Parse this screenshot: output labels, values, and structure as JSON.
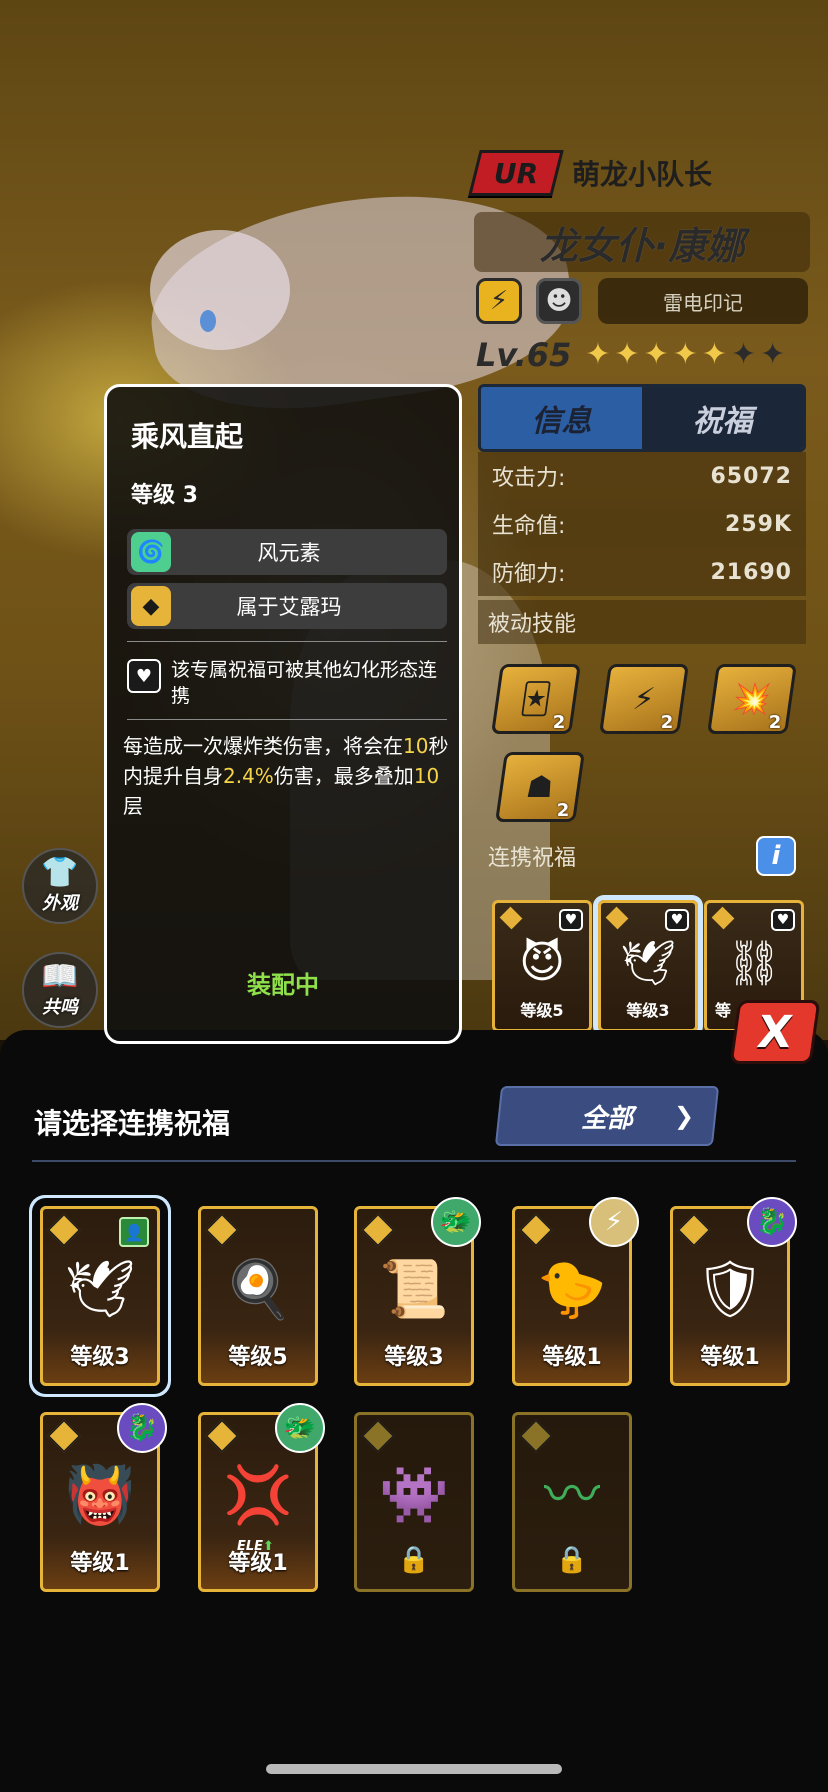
{
  "hero": {
    "rarity": "UR",
    "title": "萌龙小队长",
    "name": "龙女仆·康娜",
    "mark_label": "雷电印记",
    "level": "Lv.65",
    "stars_filled": 5,
    "stars_total": 7
  },
  "tabs": [
    "信息",
    "祝福"
  ],
  "stats": [
    {
      "label": "攻击力:",
      "value": "65072"
    },
    {
      "label": "生命值:",
      "value": "259K"
    },
    {
      "label": "防御力:",
      "value": "21690"
    }
  ],
  "passive": {
    "heading": "被动技能",
    "skills": [
      {
        "icon": "card-lightning-icon",
        "count": "2"
      },
      {
        "icon": "lightning-burst-icon",
        "count": "2"
      },
      {
        "icon": "explosion-icon",
        "count": "2"
      },
      {
        "icon": "horned-helmet-icon",
        "count": "2"
      }
    ]
  },
  "linked_blessing": {
    "heading": "连携祝福",
    "info_icon": "i",
    "cards": [
      {
        "level": "等级5",
        "icon": "purple-demon-icon"
      },
      {
        "level": "等级3",
        "icon": "wind-bird-icon"
      },
      {
        "level": "等",
        "icon": "lightning-chain-icon"
      }
    ]
  },
  "side_buttons": [
    {
      "label": "外观",
      "icon": "shirt-icon"
    },
    {
      "label": "共鸣",
      "icon": "book-icon"
    }
  ],
  "tooltip": {
    "title": "乘风直起",
    "level": "等级 3",
    "tags": [
      "风元素",
      "属于艾露玛"
    ],
    "link_note": "该专属祝福可被其他幻化形态连携",
    "desc_parts": [
      {
        "text": "每造成一次爆炸类伤害，将会在",
        "hl": false
      },
      {
        "text": "10",
        "hl": true
      },
      {
        "text": "秒内提升自身",
        "hl": false
      },
      {
        "text": "2.4%",
        "hl": true
      },
      {
        "text": "伤害，最多叠加",
        "hl": false
      },
      {
        "text": "10",
        "hl": true
      },
      {
        "text": "层",
        "hl": false
      }
    ],
    "equipped": "装配中"
  },
  "sheet": {
    "close": "X",
    "title": "请选择连携祝福",
    "filter": "全部",
    "cards": [
      {
        "level": "等级3",
        "art": "wind-bird-icon",
        "locked": false,
        "selected": true,
        "badge": "equipped-icon"
      },
      {
        "level": "等级5",
        "art": "fried-egg-icon",
        "locked": false,
        "selected": false,
        "badge": ""
      },
      {
        "level": "等级3",
        "art": "ice-scroll-icon",
        "locked": false,
        "selected": false,
        "badge": "dragon-avatar-icon"
      },
      {
        "level": "等级1",
        "art": "thunder-bird-icon",
        "locked": false,
        "selected": false,
        "badge": "lightning-avatar-icon"
      },
      {
        "level": "等级1",
        "art": "ice-shield-icon",
        "locked": false,
        "selected": false,
        "badge": "purple-avatar-icon"
      },
      {
        "level": "等级1",
        "art": "green-demon-icon",
        "locked": false,
        "selected": false,
        "badge": "purple-avatar-icon"
      },
      {
        "level": "等级1",
        "art": "red-star-icon",
        "locked": false,
        "selected": false,
        "badge": "dragon-avatar-icon",
        "ele": "ELE"
      },
      {
        "level": "",
        "art": "purple-blob-icon",
        "locked": true,
        "selected": false,
        "badge": ""
      },
      {
        "level": "",
        "art": "green-wind-icon",
        "locked": true,
        "selected": false,
        "badge": ""
      }
    ]
  }
}
